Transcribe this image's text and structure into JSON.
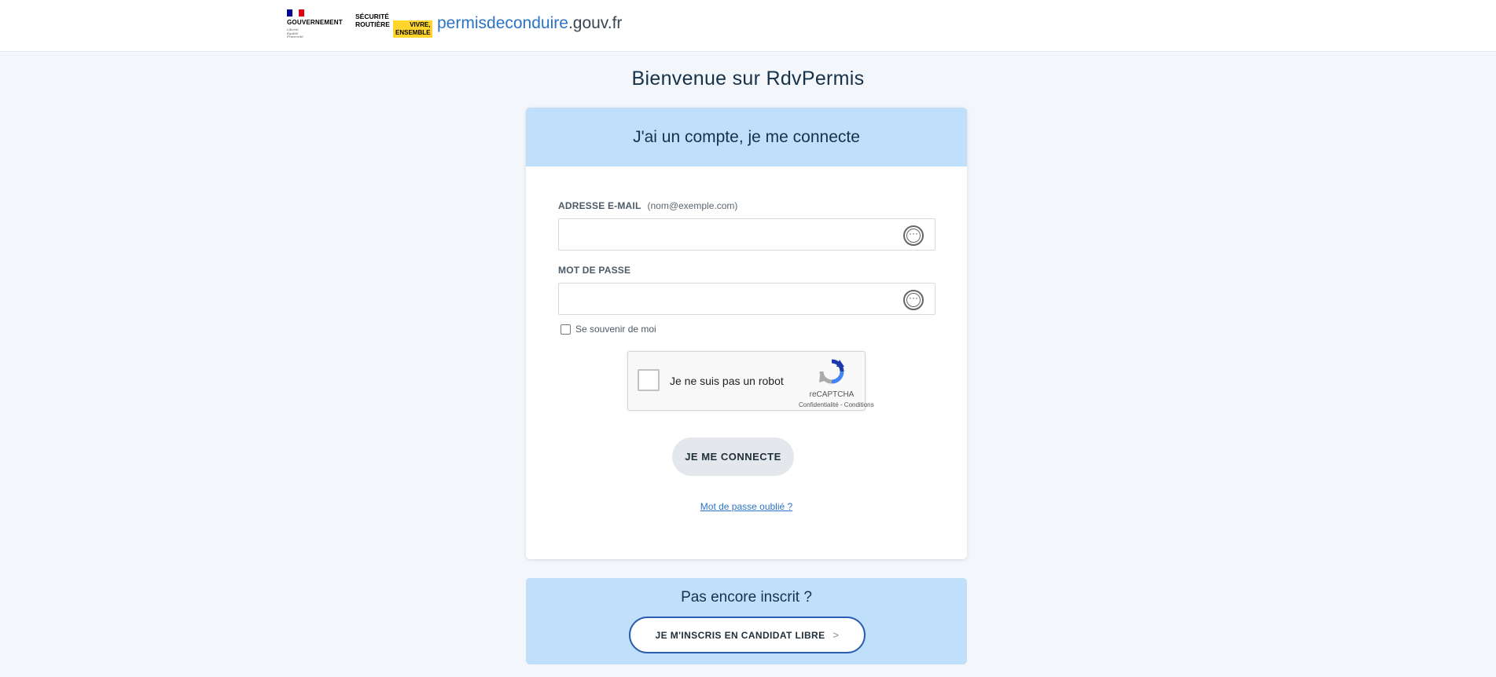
{
  "header": {
    "gov_logo_title": "GOUVERNEMENT",
    "gov_motto": [
      "Liberté",
      "Égalité",
      "Fraternité"
    ],
    "securite_routiere": [
      "SÉCURITÉ",
      "ROUTIÈRE"
    ],
    "securite_badge": [
      "VIVRE,",
      "ENSEMBLE"
    ],
    "site_name_primary": "permisdeconduire",
    "site_name_suffix": ".gouv.fr"
  },
  "page": {
    "title": "Bienvenue sur RdvPermis"
  },
  "login_card": {
    "heading": "J'ai un compte, je me connecte",
    "email_label": "ADRESSE E-MAIL",
    "email_hint": "(nom@exemple.com)",
    "email_value": "",
    "password_label": "MOT DE PASSE",
    "password_value": "",
    "remember_label": "Se souvenir de moi",
    "remember_checked": false,
    "captcha_label": "Je ne suis pas un robot",
    "captcha_brand": "reCAPTCHA",
    "captcha_links": "Confidentialité - Conditions",
    "submit_label": "JE ME CONNECTE",
    "forgot_label": "Mot de passe oublié ?"
  },
  "signup": {
    "title": "Pas encore inscrit ?",
    "button_label": "JE M'INSCRIS EN CANDIDAT LIBRE"
  },
  "colors": {
    "brand_blue": "#2a73c6",
    "header_panel": "#bfdffb",
    "page_bg": "#f3f6fa",
    "flag_blue": "#000091",
    "flag_red": "#e1000f",
    "badge_yellow": "#ffd52b"
  },
  "icons": [
    "password-manager-icon",
    "recaptcha-logo-icon",
    "chevron-right-icon"
  ]
}
